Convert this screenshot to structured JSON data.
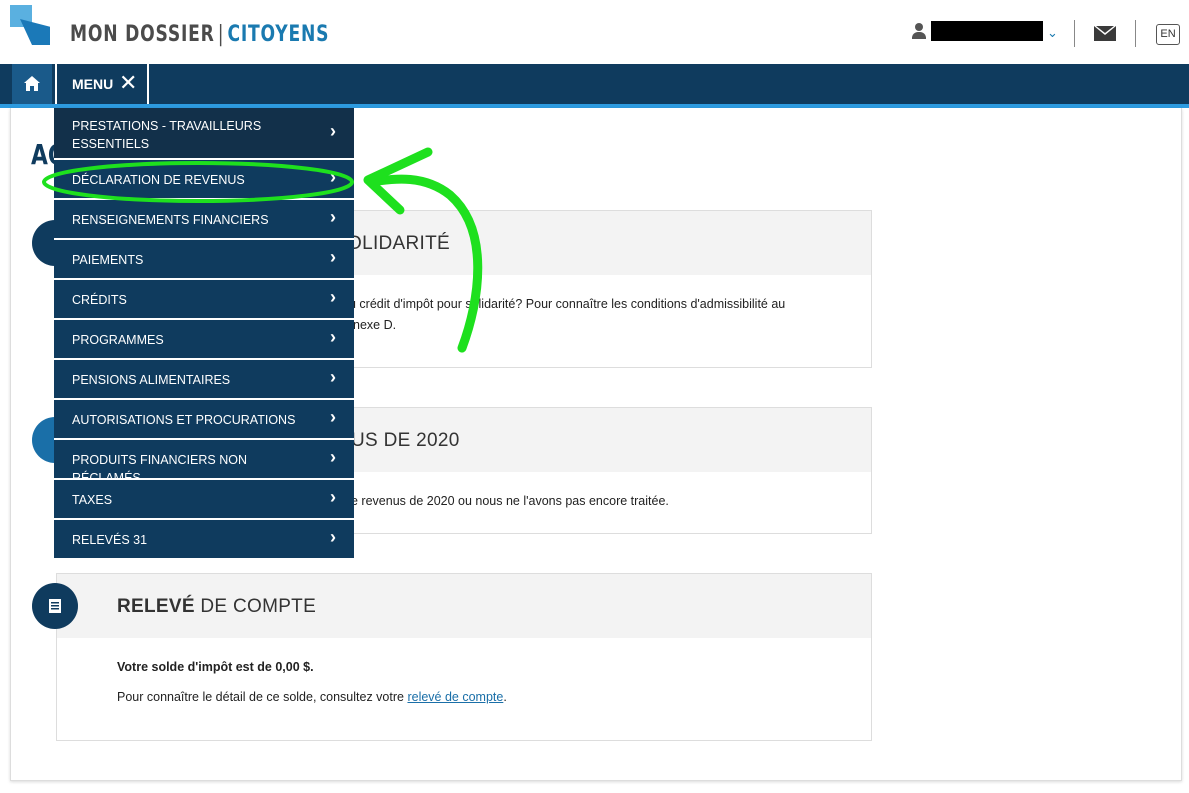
{
  "header": {
    "brand_left": "MON DOSSIER",
    "brand_sep": "|",
    "brand_right": "CITOYENS",
    "user_name": "",
    "lang": "EN"
  },
  "navbar": {
    "menu_label": "MENU",
    "close_symbol": "✕"
  },
  "page_title": "AC",
  "menu": {
    "items": [
      {
        "label": "PRESTATIONS - TRAVAILLEURS ESSENTIELS"
      },
      {
        "label": "DÉCLARATION DE REVENUS"
      },
      {
        "label": "RENSEIGNEMENTS FINANCIERS"
      },
      {
        "label": "PAIEMENTS"
      },
      {
        "label": "CRÉDITS"
      },
      {
        "label": "PROGRAMMES"
      },
      {
        "label": "PENSIONS ALIMENTAIRES"
      },
      {
        "label": "AUTORISATIONS ET PROCURATIONS"
      },
      {
        "label": "PRODUITS FINANCIERS NON RÉCLAMÉS"
      },
      {
        "label": "TAXES"
      },
      {
        "label": "RELEVÉS 31"
      }
    ],
    "arrow": "›"
  },
  "cards": {
    "c1": {
      "title": "OLIDARITÉ",
      "line1": "u crédit d'impôt pour solidarité? Pour connaître les conditions d'admissibilité au",
      "line2": "nexe D."
    },
    "c2": {
      "title": "US DE 2020",
      "line1": "e revenus de 2020 ou nous ne l'avons pas encore traitée."
    },
    "c3": {
      "title_bold": "RELEVÉ",
      "title_rest": " DE COMPTE",
      "balance": "Votre solde d'impôt est de 0,00 $.",
      "detail_prefix": "Pour connaître le détail de ce solde, consultez votre ",
      "detail_link": "relevé de compte",
      "detail_suffix": "."
    }
  },
  "colors": {
    "navy": "#0f3b5e",
    "accent_blue": "#1a7ab0",
    "annotation_green": "#1ee01e"
  }
}
